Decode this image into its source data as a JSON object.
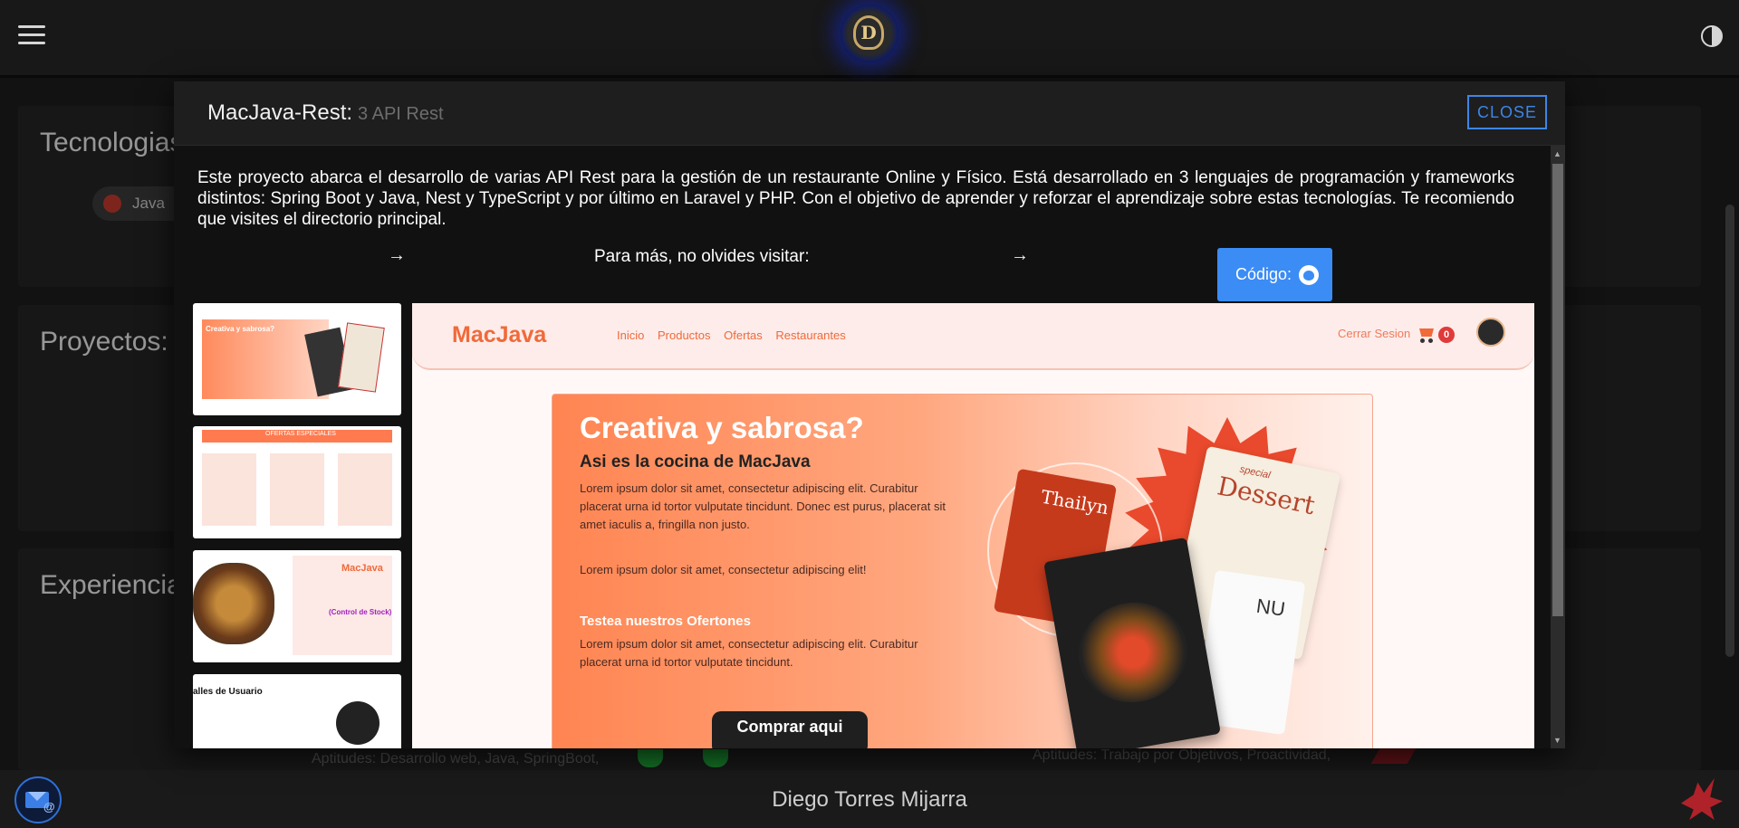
{
  "page": {
    "sections": [
      "Tecnologias",
      "Proyectos:",
      "Experiencia"
    ],
    "chip_label": "Java",
    "skills_left": "Aptitudes: Desarrollo web, Java, SpringBoot,",
    "skills_right": "Aptitudes: Trabajo por Objetivos, Proactividad,",
    "footer_name": "Diego Torres Mijarra"
  },
  "modal": {
    "title": "MacJava-Rest:",
    "subtitle": "3 API Rest",
    "close_label": "CLOSE",
    "description": "Este proyecto abarca el desarrollo de varias API Rest para la gestión de un restaurante Online y Físico. Está desarrollado en 3 lenguajes de programación y frameworks distintos: Spring Boot y Java, Nest y TypeScript y por último en Laravel y PHP. Con el objetivo de aprender y reforzar el aprendizaje sobre estas tecnologías. Te recomiendo que visites el directorio principal.",
    "arrow_glyph": "→",
    "visit_text": "Para más, no olvides visitar:",
    "code_button": "Código:"
  },
  "preview": {
    "brand": "MacJava",
    "nav_links": [
      "Inicio",
      "Productos",
      "Ofertas",
      "Restaurantes"
    ],
    "logout": "Cerrar Sesion",
    "cart_count": "0",
    "hero_title": "Creativa y sabrosa?",
    "hero_subtitle": "Asi es la cocina de MacJava",
    "hero_p1": "Lorem ipsum dolor sit amet, consectetur adipiscing elit. Curabitur placerat urna id tortor vulputate tincidunt. Donec est purus, placerat sit amet iaculis a, fringilla non justo.",
    "hero_p2": "Lorem ipsum dolor sit amet, consectetur adipiscing elit!",
    "offers_title": "Testea nuestros Ofertones",
    "offers_p": "Lorem ipsum dolor sit amet, consectetur adipiscing elit. Curabitur placerat urna id tortor vulputate tincidunt.",
    "cta": "Comprar aqui",
    "menu_card_red": "Thailyn",
    "menu_card_dessert": "Dessert",
    "menu_card_dessert_sub": "special",
    "menu_card_white": "NU"
  },
  "thumbnails": {
    "t1": "Creativa y sabrosa?",
    "t2": "OFERTAS ESPECIALES",
    "t3": "MacJava",
    "t3_stock": "(Control de Stock)",
    "t4": "alles de Usuario"
  },
  "colors": {
    "accent_blue": "#3b8cf5",
    "brand_orange": "#f06a3a",
    "badge_red": "#e03a3a"
  }
}
